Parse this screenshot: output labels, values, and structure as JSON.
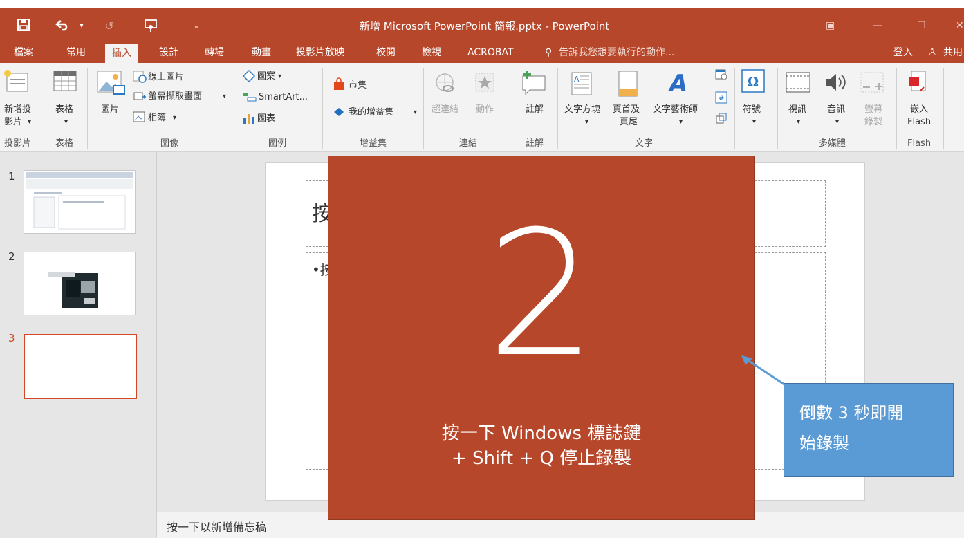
{
  "window": {
    "title": "新增 Microsoft PowerPoint 簡報.pptx - PowerPoint"
  },
  "tabs": [
    {
      "label": "檔案"
    },
    {
      "label": "常用"
    },
    {
      "label": "插入"
    },
    {
      "label": "設計"
    },
    {
      "label": "轉場"
    },
    {
      "label": "動畫"
    },
    {
      "label": "投影片放映"
    },
    {
      "label": "校閱"
    },
    {
      "label": "檢視"
    },
    {
      "label": "ACROBAT"
    }
  ],
  "tell_me": "告訴我您想要執行的動作...",
  "account": {
    "signin": "登入",
    "share": "共用"
  },
  "ribbon": {
    "new_slide": [
      "新增投",
      "影片"
    ],
    "table": "表格",
    "pictures": "圖片",
    "online_pictures": "線上圖片",
    "screenshot": "螢幕擷取畫面",
    "photo_album": "相簿",
    "shapes": "圖案",
    "smartart": "SmartArt...",
    "chart": "圖表",
    "store": "市集",
    "my_addins": "我的增益集",
    "hyperlink": "超連結",
    "action": "動作",
    "comment": "註解",
    "textbox": "文字方塊",
    "header_footer": [
      "頁首及",
      "頁尾"
    ],
    "wordart": "文字藝術師",
    "symbols": "符號",
    "video": "視訊",
    "audio": "音訊",
    "screen_record": [
      "螢幕",
      "錄製"
    ],
    "embed_flash": [
      "嵌入",
      "Flash"
    ],
    "groups": {
      "slides": "投影片",
      "tables": "表格",
      "images": "圖像",
      "illustrations": "圖例",
      "addins": "增益集",
      "links": "連結",
      "comments": "註解",
      "text": "文字",
      "media": "多媒體",
      "flash": "Flash"
    }
  },
  "thumbnails": [
    {
      "number": "1"
    },
    {
      "number": "2"
    },
    {
      "number": "3"
    }
  ],
  "slide": {
    "title_partial": "按",
    "bullet_partial": "•按"
  },
  "countdown": {
    "number": "2",
    "line1": "按一下 Windows 標誌鍵",
    "line2": "+ Shift + Q 停止錄製"
  },
  "callout": {
    "line1": "倒數 3 秒即開",
    "line2": "始錄製"
  },
  "notes": {
    "placeholder": "按一下以新增備忘稿"
  },
  "colors": {
    "brand": "#b7472a",
    "ribbon": "#f3f3f3",
    "callout": "#5b9bd5",
    "selection": "#d24726"
  }
}
